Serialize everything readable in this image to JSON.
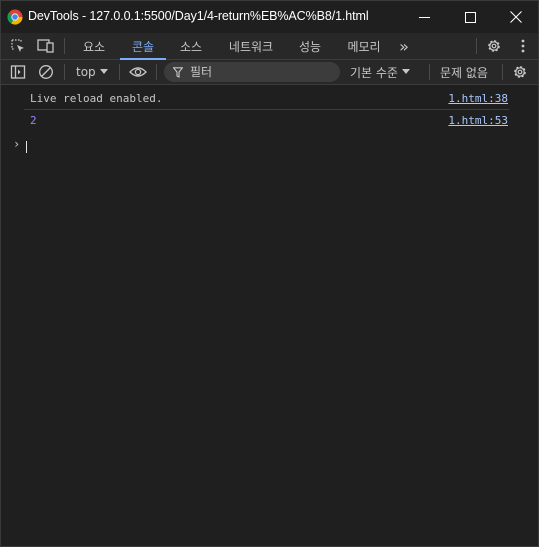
{
  "window": {
    "title": "DevTools - 127.0.0.1:5500/Day1/4-return%EB%AC%B8/1.html"
  },
  "tabs": [
    {
      "label": "요소",
      "active": false
    },
    {
      "label": "콘솔",
      "active": true
    },
    {
      "label": "소스",
      "active": false
    },
    {
      "label": "네트워크",
      "active": false
    },
    {
      "label": "성능",
      "active": false
    },
    {
      "label": "메모리",
      "active": false
    }
  ],
  "more_tabs_label": "»",
  "console_toolbar": {
    "context": "top",
    "filter_placeholder": "필터",
    "levels": "기본 수준",
    "issues": "문제 없음"
  },
  "messages": [
    {
      "text": "Live reload enabled.",
      "source": "1.html:38",
      "type": "log"
    },
    {
      "text": "2",
      "source": "1.html:53",
      "type": "number"
    }
  ],
  "prompt_symbol": "›",
  "colors": {
    "background": "#1f1f1f",
    "toolbar": "#282828",
    "accent": "#7cacf8",
    "link": "#a8c7fa",
    "number": "#9980ff"
  },
  "icons": [
    "chrome-logo",
    "minimize-icon",
    "maximize-icon",
    "close-icon",
    "inspect-element-icon",
    "device-toolbar-icon",
    "settings-gear-icon",
    "kebab-menu-icon",
    "sidebar-toggle-icon",
    "clear-console-icon",
    "eye-icon",
    "filter-icon",
    "dropdown-arrow-icon"
  ]
}
